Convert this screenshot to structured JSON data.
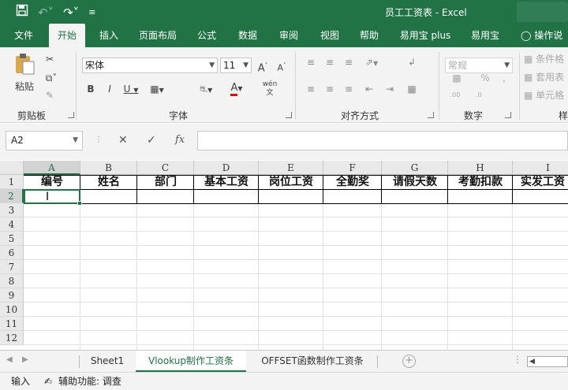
{
  "window": {
    "title": "员工工资表 - Excel"
  },
  "qat": {
    "save_icon": "save-icon",
    "undo_icon": "undo-icon",
    "redo_icon": "redo-icon"
  },
  "tabs": [
    {
      "label": "文件"
    },
    {
      "label": "开始"
    },
    {
      "label": "插入"
    },
    {
      "label": "页面布局"
    },
    {
      "label": "公式"
    },
    {
      "label": "数据"
    },
    {
      "label": "审阅"
    },
    {
      "label": "视图"
    },
    {
      "label": "帮助"
    },
    {
      "label": "易用宝 plus"
    },
    {
      "label": "易用宝"
    },
    {
      "label": "操作说"
    }
  ],
  "ribbon": {
    "paste_label": "粘贴",
    "clipboard_label": "剪贴板",
    "font_name": "宋体",
    "font_size": "11",
    "font_label": "字体",
    "align_label": "对齐方式",
    "number_format": "常规",
    "number_label": "数字",
    "style_items": [
      "条件格",
      "套用表",
      "单元格"
    ],
    "styles_label": "样"
  },
  "formula_bar": {
    "name_box": "A2",
    "fx_label": "fx",
    "formula": ""
  },
  "columns": [
    "A",
    "B",
    "C",
    "D",
    "E",
    "F",
    "G",
    "H",
    "I"
  ],
  "rows": [
    "1",
    "2",
    "3",
    "4",
    "5",
    "6",
    "7",
    "8",
    "9",
    "10",
    "11",
    "12"
  ],
  "headers": [
    "编号",
    "姓名",
    "部门",
    "基本工资",
    "岗位工资",
    "全勤奖",
    "请假天数",
    "考勤扣款",
    "实发工资"
  ],
  "sheets": [
    {
      "label": "Sheet1"
    },
    {
      "label": "Vlookup制作工资条"
    },
    {
      "label": "OFFSET函数制作工资条"
    }
  ],
  "status": {
    "mode": "输入",
    "accessibility": "辅助功能: 调查"
  },
  "colors": {
    "accent": "#217346"
  }
}
